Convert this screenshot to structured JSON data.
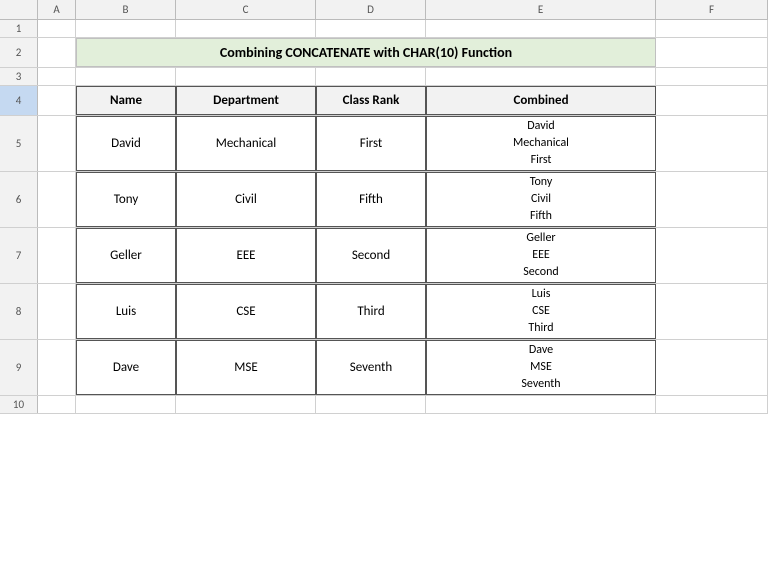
{
  "title": "Combining CONCATENATE with CHAR(10) Function",
  "columns": [
    "A",
    "B",
    "C",
    "D",
    "E",
    "F"
  ],
  "rows": {
    "row1": {
      "num": "1"
    },
    "row2": {
      "num": "2"
    },
    "row3": {
      "num": "3"
    },
    "row4": {
      "num": "4"
    },
    "row5": {
      "num": "5"
    },
    "row6": {
      "num": "6"
    },
    "row7": {
      "num": "7"
    },
    "row8": {
      "num": "8"
    },
    "row9": {
      "num": "9"
    },
    "row10": {
      "num": "10"
    }
  },
  "table": {
    "headers": {
      "name": "Name",
      "department": "Department",
      "classrank": "Class Rank",
      "combined": "Combined"
    },
    "data": [
      {
        "name": "David",
        "department": "Mechanical",
        "rank": "First",
        "combined_lines": [
          "David",
          "Mechanical",
          "First"
        ]
      },
      {
        "name": "Tony",
        "department": "Civil",
        "rank": "Fifth",
        "combined_lines": [
          "Tony",
          "Civil",
          "Fifth"
        ]
      },
      {
        "name": "Geller",
        "department": "EEE",
        "rank": "Second",
        "combined_lines": [
          "Geller",
          "EEE",
          "Second"
        ]
      },
      {
        "name": "Luis",
        "department": "CSE",
        "rank": "Third",
        "combined_lines": [
          "Luis",
          "CSE",
          "Third"
        ]
      },
      {
        "name": "Dave",
        "department": "MSE",
        "rank": "Seventh",
        "combined_lines": [
          "Dave",
          "MSE",
          "Seventh"
        ]
      }
    ]
  }
}
